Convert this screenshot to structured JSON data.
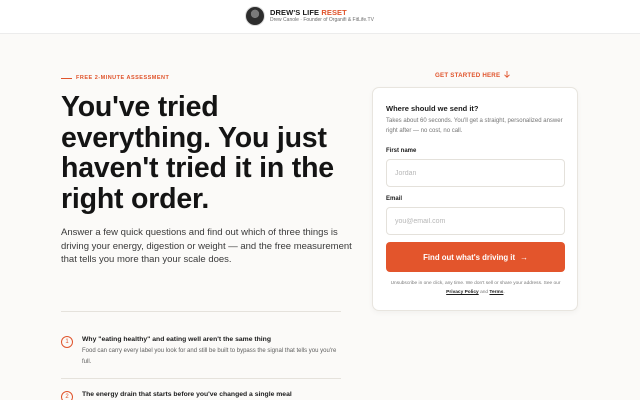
{
  "header": {
    "brand_name": "DREW'S LIFE",
    "brand_accent": "RESET",
    "tagline": "Drew Canole · Founder of Organifi & FitLife.TV"
  },
  "hero": {
    "eyebrow": "FREE 2-MINUTE ASSESSMENT",
    "headline": "You've tried everything. You just haven't tried it in the right order.",
    "lede": "Answer a few quick questions and find out which of three things is driving your energy, digestion or weight — and the free measurement that tells you more than your scale does."
  },
  "list": [
    {
      "number": "1",
      "title": "Why \"eating healthy\" and eating well aren't the same thing",
      "desc": "Food can carry every label you look for and still be built to bypass the signal that tells you you're full."
    },
    {
      "number": "2",
      "title": "The energy drain that starts before you've changed a single meal",
      "desc": ""
    }
  ],
  "get_started": {
    "label": "GET STARTED HERE",
    "arrow_icon": "arrow-down-icon"
  },
  "form": {
    "title": "Where should we send it?",
    "subtitle": "Takes about 60 seconds. You'll get a straight, personalized answer right after — no cost, no call.",
    "first_name_label": "First name",
    "first_name_placeholder": "Jordan",
    "first_name_value": "",
    "email_label": "Email",
    "email_placeholder": "you@email.com",
    "email_value": "",
    "submit_label": "Find out what's driving it",
    "submit_arrow": "→",
    "fine_print_pre": "Unsubscribe in one click, any time. We don't sell or share your address. See our",
    "privacy_link": "Privacy Policy",
    "fine_print_and": "and",
    "terms_link": "Terms",
    "fine_print_end": "."
  },
  "colors": {
    "accent": "#e0542c",
    "background": "#fbfaf8",
    "card": "#ffffff",
    "text": "#141414"
  }
}
